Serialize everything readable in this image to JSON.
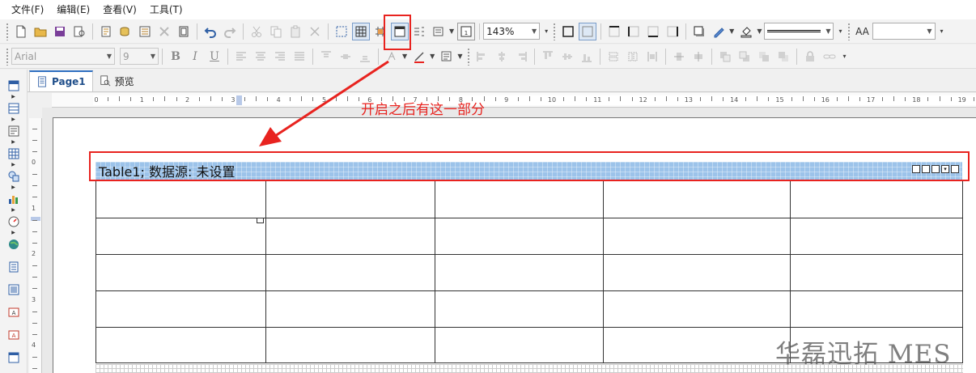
{
  "menu": {
    "file": "文件(F)",
    "edit": "编辑(E)",
    "view": "查看(V)",
    "tools": "工具(T)"
  },
  "toolbar": {
    "zoom_value": "143%",
    "font_name": "Arial",
    "font_size": "9",
    "bold": "B",
    "italic": "I",
    "underline": "U",
    "font_style_glyph": "AA",
    "style_value": ""
  },
  "tabs": {
    "page1": "Page1",
    "preview": "预览"
  },
  "ruler": {
    "h_labels": [
      "0",
      "1",
      "2",
      "3",
      "4",
      "5",
      "6",
      "7",
      "8",
      "9",
      "10",
      "11",
      "12",
      "13",
      "14",
      "15",
      "16",
      "17",
      "18",
      "19"
    ],
    "v_labels": [
      "0",
      "1",
      "2",
      "3",
      "4"
    ]
  },
  "table": {
    "title": "Table1; 数据源: 未设置",
    "columns": 5,
    "rows": 5
  },
  "annotation": {
    "note": "开启之后有这一部分",
    "color": "#e8231f"
  },
  "watermark": "华磊迅拓 MES"
}
